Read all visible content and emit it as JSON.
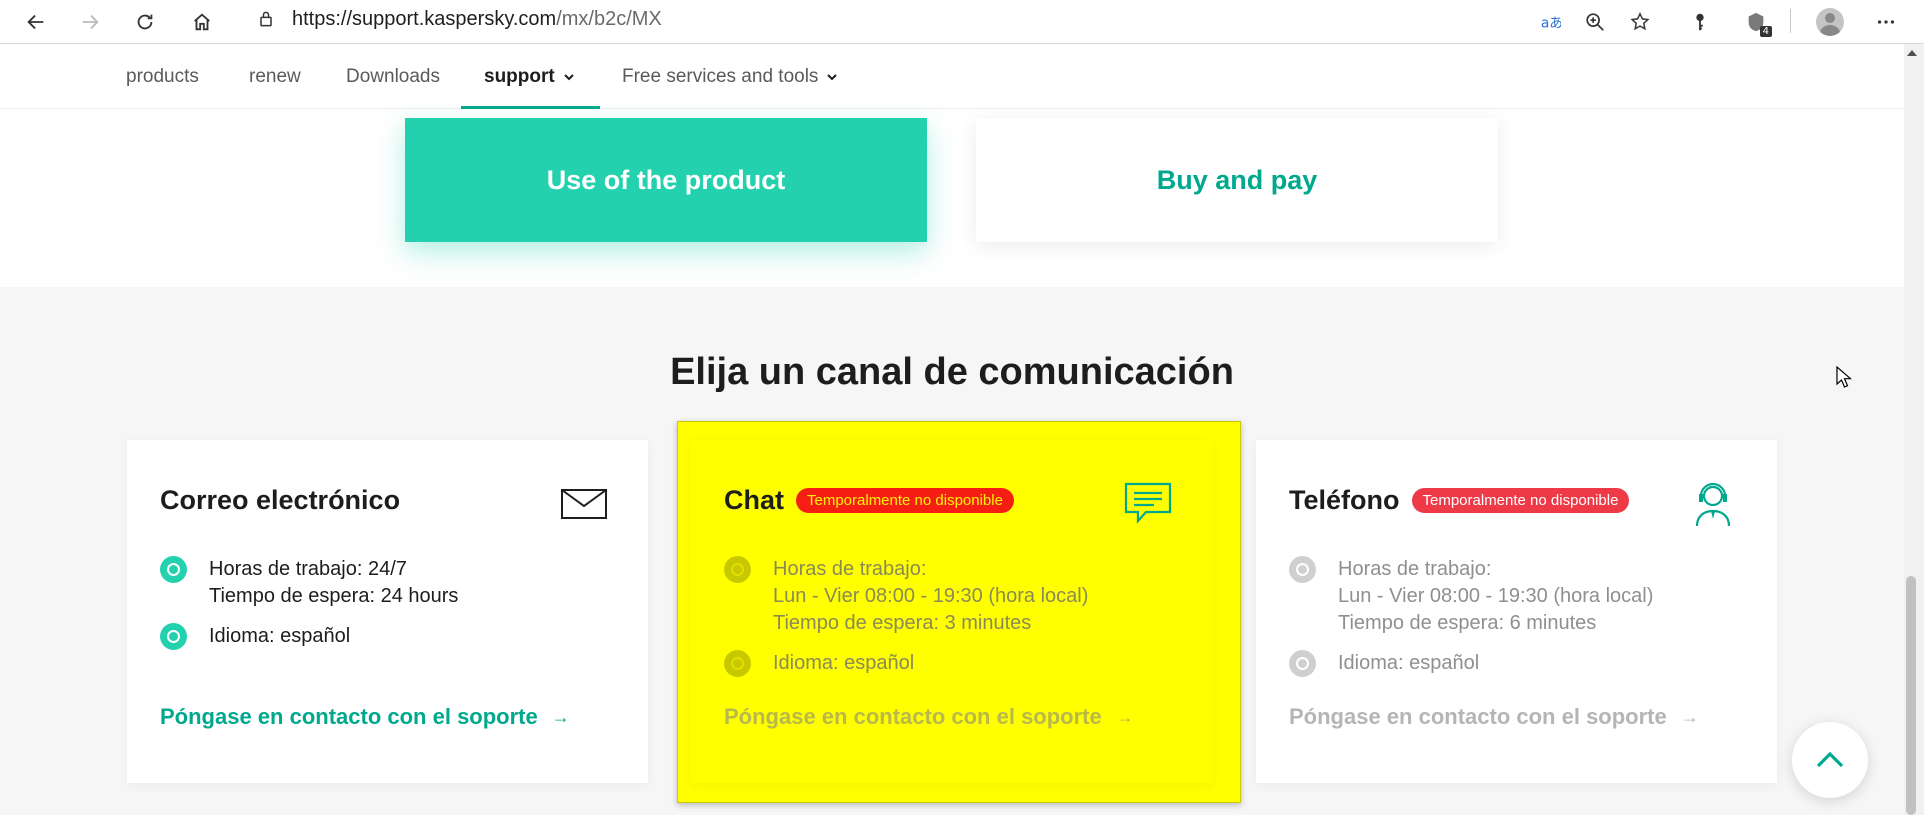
{
  "browser": {
    "url_host": "https://support.kaspersky.com",
    "url_path": "/mx/b2c/MX",
    "extension_badge": "4",
    "icons": [
      "back-icon",
      "forward-icon",
      "refresh-icon",
      "home-icon",
      "lock-icon",
      "read-aloud-icon",
      "zoom-icon",
      "favorites-icon",
      "key-icon",
      "extension-icon",
      "profile-icon",
      "more-icon"
    ]
  },
  "nav": {
    "items": [
      {
        "label": "products"
      },
      {
        "label": "renew"
      },
      {
        "label": "Downloads"
      },
      {
        "label": "support"
      },
      {
        "label": "Free services and tools"
      }
    ],
    "active_index": 3
  },
  "tiles": {
    "primary": "Use of the product",
    "secondary": "Buy and pay"
  },
  "channels": {
    "title": "Elija un canal de comunicación",
    "cards": [
      {
        "title": "Correo electrónico",
        "badge": "",
        "icon": "envelope-icon",
        "hours": [
          "Horas de trabajo: 24/7",
          "Tiempo de espera: 24 hours"
        ],
        "language": "Idioma: español",
        "link": "Póngase en contacto con el soporte",
        "enabled": true
      },
      {
        "title": "Chat",
        "badge": "Temporalmente no disponible",
        "icon": "chat-icon",
        "hours": [
          "Horas de trabajo:",
          "Lun - Vier 08:00 - 19:30 (hora local)",
          "Tiempo de espera: 3 minutes"
        ],
        "language": "Idioma: español",
        "link": "Póngase en contacto con el soporte",
        "enabled": false
      },
      {
        "title": "Teléfono",
        "badge": "Temporalmente no disponible",
        "icon": "headset-icon",
        "hours": [
          "Horas de trabajo:",
          "Lun - Vier 08:00 - 19:30 (hora local)",
          "Tiempo de espera: 6 minutes"
        ],
        "language": "Idioma: español",
        "link": "Póngase en contacto con el soporte",
        "enabled": false
      }
    ]
  },
  "colors": {
    "accent": "#00a88e",
    "tile": "#23d1ae",
    "badge": "#ee3a46",
    "highlight": "#ffff00"
  },
  "arrow_glyph": "→"
}
